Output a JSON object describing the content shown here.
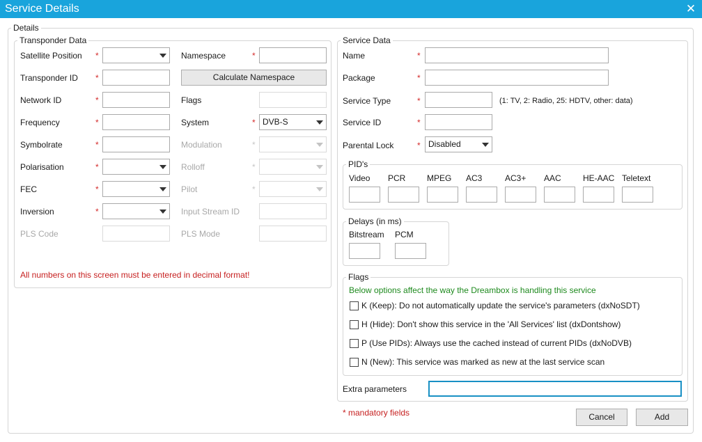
{
  "window": {
    "title": "Service Details",
    "close_glyph": "✕"
  },
  "details": {
    "title": "Details"
  },
  "transponder": {
    "title": "Transponder Data",
    "satellite_position": {
      "label": "Satellite Position",
      "value": ""
    },
    "transponder_id": {
      "label": "Transponder ID",
      "value": ""
    },
    "network_id": {
      "label": "Network ID",
      "value": ""
    },
    "frequency": {
      "label": "Frequency",
      "value": ""
    },
    "symbolrate": {
      "label": "Symbolrate",
      "value": ""
    },
    "polarisation": {
      "label": "Polarisation",
      "value": ""
    },
    "fec": {
      "label": "FEC",
      "value": ""
    },
    "inversion": {
      "label": "Inversion",
      "value": ""
    },
    "pls_code": {
      "label": "PLS Code",
      "value": ""
    },
    "namespace": {
      "label": "Namespace",
      "value": ""
    },
    "calculate_namespace": {
      "label": "Calculate Namespace"
    },
    "flags": {
      "label": "Flags",
      "value": ""
    },
    "system": {
      "label": "System",
      "value": "DVB-S"
    },
    "modulation": {
      "label": "Modulation",
      "value": ""
    },
    "rolloff": {
      "label": "Rolloff",
      "value": ""
    },
    "pilot": {
      "label": "Pilot",
      "value": ""
    },
    "input_stream_id": {
      "label": "Input Stream ID",
      "value": ""
    },
    "pls_mode": {
      "label": "PLS Mode",
      "value": ""
    },
    "decimal_warning": "All numbers on this screen must be entered in decimal format!"
  },
  "service": {
    "title": "Service Data",
    "name": {
      "label": "Name",
      "value": ""
    },
    "package": {
      "label": "Package",
      "value": ""
    },
    "service_type": {
      "label": "Service Type",
      "value": "",
      "hint": "(1: TV, 2: Radio, 25: HDTV, other: data)"
    },
    "service_id": {
      "label": "Service ID",
      "value": ""
    },
    "parental_lock": {
      "label": "Parental Lock",
      "value": "Disabled"
    },
    "pids": {
      "title": "PID's",
      "fields": [
        {
          "label": "Video",
          "value": ""
        },
        {
          "label": "PCR",
          "value": ""
        },
        {
          "label": "MPEG",
          "value": ""
        },
        {
          "label": "AC3",
          "value": ""
        },
        {
          "label": "AC3+",
          "value": ""
        },
        {
          "label": "AAC",
          "value": ""
        },
        {
          "label": "HE-AAC",
          "value": ""
        },
        {
          "label": "Teletext",
          "value": ""
        }
      ]
    },
    "delays": {
      "title": "Delays (in ms)",
      "fields": [
        {
          "label": "Bitstream",
          "value": ""
        },
        {
          "label": "PCM",
          "value": ""
        }
      ]
    },
    "flags": {
      "title": "Flags",
      "note": "Below options affect the way the Dreambox is handling this service",
      "options": [
        {
          "label": "K (Keep): Do not automatically update the service's parameters (dxNoSDT)",
          "checked": false
        },
        {
          "label": "H (Hide): Don't show this service in the 'All Services' list (dxDontshow)",
          "checked": false
        },
        {
          "label": "P (Use PIDs): Always use the cached instead of current PIDs (dxNoDVB)",
          "checked": false
        },
        {
          "label": "N (New): This service was marked as new at the last service scan",
          "checked": false
        }
      ]
    },
    "extra_parameters": {
      "label": "Extra parameters",
      "value": ""
    }
  },
  "mandatory_note": "* mandatory fields",
  "required_marker": "*",
  "buttons": {
    "cancel": "Cancel",
    "add": "Add"
  },
  "colors": {
    "titlebar": "#19a4dc",
    "required": "#d42b2b",
    "warning": "#c62020",
    "note": "#1e8a1e"
  }
}
